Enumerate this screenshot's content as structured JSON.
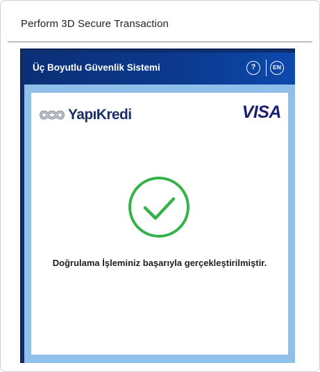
{
  "dialog": {
    "title": "Perform 3D Secure Transaction"
  },
  "secure_frame": {
    "header_title": "Üç Boyutlu Güvenlik Sistemi",
    "help_label": "?",
    "language_label": "EN",
    "bank_name": "YapıKredi",
    "card_brand": "VISA",
    "status_message": "Doğrulama İşleminiz başarıyla gerçekleştirilmiştir."
  },
  "colors": {
    "header_blue": "#0c3a8f",
    "band_light_blue": "#8fc0ea",
    "success_green": "#35b34a",
    "visa_navy": "#1a1f71"
  },
  "icons": {
    "success": "check-circle-icon",
    "bank_logo": "yapikredi-logo-icon",
    "help": "question-icon"
  }
}
